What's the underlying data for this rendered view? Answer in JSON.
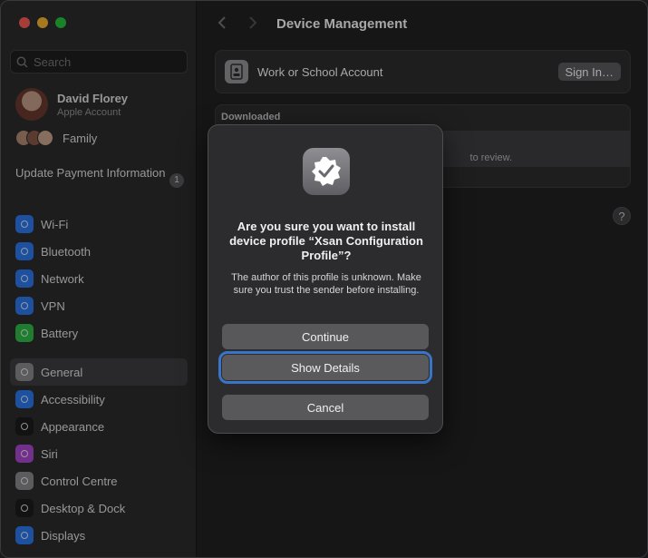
{
  "sidebar": {
    "search_placeholder": "Search",
    "account": {
      "name": "David Florey",
      "subtitle": "Apple Account"
    },
    "family_label": "Family",
    "update_payment": {
      "label": "Update Payment Information",
      "badge": "1"
    },
    "items_group1": [
      {
        "label": "Wi-Fi",
        "icon": "wifi-icon",
        "color": "#2f7cf6"
      },
      {
        "label": "Bluetooth",
        "icon": "bluetooth-icon",
        "color": "#2f7cf6"
      },
      {
        "label": "Network",
        "icon": "network-icon",
        "color": "#2f7cf6"
      },
      {
        "label": "VPN",
        "icon": "vpn-icon",
        "color": "#2f7cf6"
      },
      {
        "label": "Battery",
        "icon": "battery-icon",
        "color": "#30c04a"
      }
    ],
    "items_group2": [
      {
        "label": "General",
        "icon": "gear-icon",
        "color": "#8e8e93",
        "selected": true
      },
      {
        "label": "Accessibility",
        "icon": "accessibility-icon",
        "color": "#2f7cf6"
      },
      {
        "label": "Appearance",
        "icon": "appearance-icon",
        "color": "#1c1c1e"
      },
      {
        "label": "Siri",
        "icon": "siri-icon",
        "color": "#b04ad8"
      },
      {
        "label": "Control Centre",
        "icon": "control-centre-icon",
        "color": "#8e8e93"
      },
      {
        "label": "Desktop & Dock",
        "icon": "dock-icon",
        "color": "#1c1c1e"
      },
      {
        "label": "Displays",
        "icon": "displays-icon",
        "color": "#2f7cf6"
      }
    ]
  },
  "main": {
    "title": "Device Management",
    "work_account_label": "Work or School Account",
    "signin_label": "Sign In…",
    "downloaded_header": "Downloaded",
    "downloaded_hint": "to review.",
    "help_label": "?"
  },
  "dialog": {
    "title": "Are you sure you want to install device profile “Xsan Configuration Profile”?",
    "message": "The author of this profile is unknown. Make sure you trust the sender before installing.",
    "continue_label": "Continue",
    "show_details_label": "Show Details",
    "cancel_label": "Cancel"
  },
  "colors": {
    "focus_ring": "#3a74c7",
    "traffic_close": "#ff5f57",
    "traffic_min": "#febc2e",
    "traffic_max": "#28c840"
  }
}
